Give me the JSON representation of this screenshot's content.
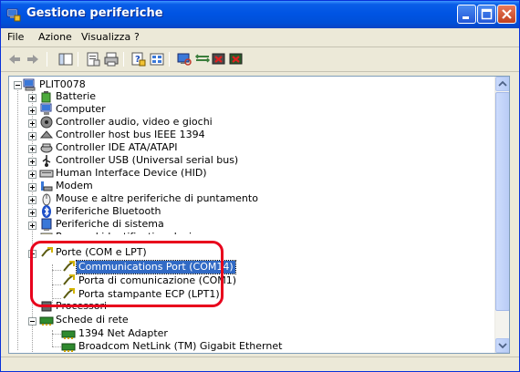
{
  "window": {
    "title": "Gestione periferiche"
  },
  "menu": [
    "File",
    "Azione",
    "Visualizza",
    "?"
  ],
  "toolbar": {
    "icons": [
      "back-icon",
      "forward-icon",
      "show-hide-tree-icon",
      "properties-icon",
      "print-icon",
      "help-icon",
      "view-icon",
      "scan-hardware-icon",
      "update-driver-icon",
      "disable-icon",
      "uninstall-icon"
    ]
  },
  "tree": {
    "root": {
      "label": "PLIT0078",
      "icon": "computer-icon"
    },
    "categories": [
      {
        "label": "Batterie",
        "icon": "battery-icon"
      },
      {
        "label": "Computer",
        "icon": "computer-icon"
      },
      {
        "label": "Controller audio, video e giochi",
        "icon": "audio-icon"
      },
      {
        "label": "Controller host bus IEEE 1394",
        "icon": "ieee1394-icon"
      },
      {
        "label": "Controller IDE ATA/ATAPI",
        "icon": "ide-icon"
      },
      {
        "label": "Controller USB (Universal serial bus)",
        "icon": "usb-icon"
      },
      {
        "label": "Human Interface Device (HID)",
        "icon": "hid-icon"
      },
      {
        "label": "Modem",
        "icon": "modem-icon"
      },
      {
        "label": "Mouse e altre periferiche di puntamento",
        "icon": "mouse-icon"
      },
      {
        "label": "Periferiche Bluetooth",
        "icon": "bluetooth-icon"
      },
      {
        "label": "Periferiche di sistema",
        "icon": "system-device-icon"
      },
      {
        "label": "Personal identification devices",
        "icon": "identification-icon"
      }
    ],
    "ports": {
      "label": "Porte (COM e LPT)",
      "icon": "port-icon",
      "children": [
        {
          "label": "Communications Port (COM14)",
          "selected": true
        },
        {
          "label": "Porta di comunicazione (COM1)",
          "selected": false
        },
        {
          "label": "Porta stampante ECP (LPT1)",
          "selected": false
        }
      ]
    },
    "after_ports": {
      "label": "Processori",
      "icon": "processor-icon"
    },
    "network": {
      "label": "Schede di rete",
      "icon": "network-adapter-icon",
      "children": [
        {
          "label": "1394 Net Adapter"
        },
        {
          "label": "Broadcom NetLink (TM) Gigabit Ethernet"
        }
      ]
    }
  },
  "colors": {
    "selection": "#316ac5",
    "highlight": "#e8001c",
    "titlebar": "#0054e3"
  }
}
